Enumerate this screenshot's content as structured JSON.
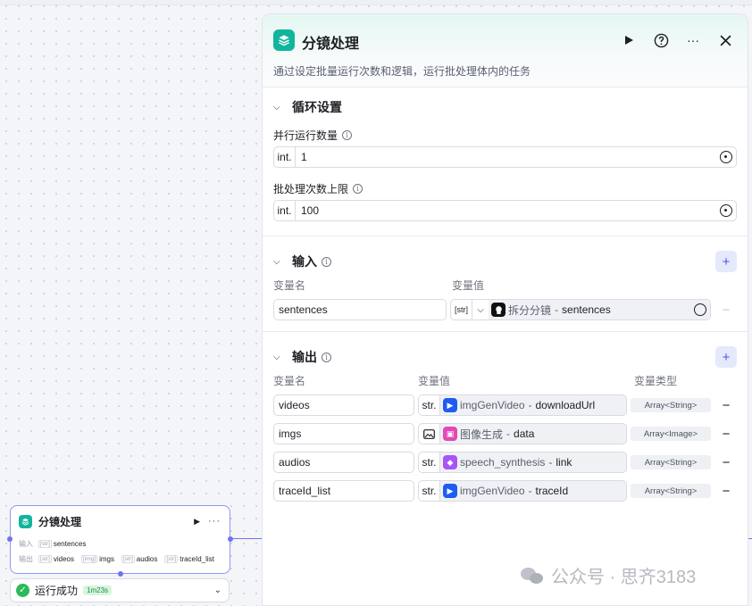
{
  "node": {
    "title": "分镜处理",
    "input_label": "输入",
    "output_label": "输出",
    "inputs": [
      {
        "type": "[str]",
        "name": "sentences"
      }
    ],
    "outputs": [
      {
        "type": "[str]",
        "name": "videos"
      },
      {
        "type": "[img]",
        "name": "imgs"
      },
      {
        "type": "[str]",
        "name": "audios"
      },
      {
        "type": "[str]",
        "name": "traceId_list"
      }
    ],
    "status_text": "运行成功",
    "status_time": "1m23s"
  },
  "panel": {
    "title": "分镜处理",
    "description": "通过设定批量运行次数和逻辑，运行批处理体内的任务",
    "loop_section": {
      "title": "循环设置",
      "parallel": {
        "label": "并行运行数量",
        "prefix": "int.",
        "value": "1"
      },
      "batch_limit": {
        "label": "批处理次数上限",
        "prefix": "int.",
        "value": "100"
      }
    },
    "input_section": {
      "title": "输入",
      "col_name": "变量名",
      "col_value": "变量值",
      "rows": [
        {
          "name": "sentences",
          "type_prefix": "[str]",
          "source": "拆分分镜",
          "field": "sentences"
        }
      ]
    },
    "output_section": {
      "title": "输出",
      "col_name": "变量名",
      "col_value": "变量值",
      "col_type": "变量类型",
      "rows": [
        {
          "name": "videos",
          "prefix": "str.",
          "source": "imgGenVideo",
          "field": "downloadUrl",
          "type": "Array<String>"
        },
        {
          "name": "imgs",
          "prefix": "img",
          "source": "图像生成",
          "field": "data",
          "type": "Array<Image>"
        },
        {
          "name": "audios",
          "prefix": "str.",
          "source": "speech_synthesis",
          "field": "link",
          "type": "Array<String>"
        },
        {
          "name": "traceId_list",
          "prefix": "str.",
          "source": "imgGenVideo",
          "field": "traceId",
          "type": "Array<String>"
        }
      ]
    },
    "separator": "-"
  },
  "watermark": "公众号 · 思齐3183",
  "colors": {
    "accent": "#4f55e8",
    "brand": "#10b59c",
    "success": "#2bbb5a"
  },
  "icons": {
    "play": "play-icon",
    "help": "help-icon",
    "more": "more-icon",
    "close": "close-icon"
  }
}
